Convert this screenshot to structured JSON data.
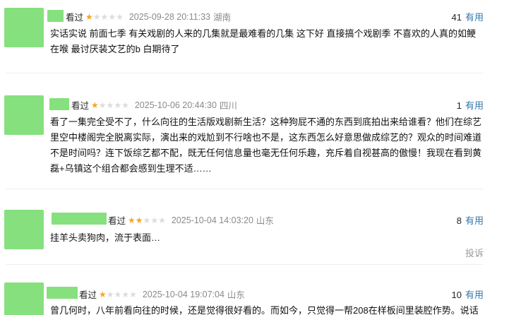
{
  "reviews": [
    {
      "label": "看过",
      "rating": 1,
      "time": "2025-09-28 20:11:33",
      "location": "湖南",
      "useful_count": "41",
      "useful_label": "有用",
      "text": "实话实说 前面七季 有关戏剧的人来的几集就是最难看的几集 这下好 直接搞个戏剧季 不喜欢的人真的如鲠在喉 最讨厌装文艺的b 白期待了"
    },
    {
      "label": "看过",
      "rating": 1,
      "time": "2025-10-06 20:44:30",
      "location": "四川",
      "useful_count": "1",
      "useful_label": "有用",
      "text": "看了一集完全受不了，什么向往的生活版戏剧新生活？这种狗屁不通的东西到底拍出来给谁看？他们在综艺里空中楼阁完全脱离实际，演出来的戏尬到不行啥也不是，这东西怎么好意思做成综艺的？观众的时间难道不是时间吗？连下饭综艺都不配，既无任何信息量也毫无任何乐趣，充斥着自视甚高的傲慢！我现在看到黄磊+乌镇这个组合都会感到生理不适……"
    },
    {
      "label": "看过",
      "rating": 2,
      "time": "2025-10-04 14:03:20",
      "location": "山东",
      "useful_count": "8",
      "useful_label": "有用",
      "text": "挂羊头卖狗肉，流于表面…",
      "report_label": "投诉"
    },
    {
      "label": "看过",
      "rating": 1,
      "time": "2025-10-04 19:07:04",
      "location": "山东",
      "useful_count": "10",
      "useful_label": "有用",
      "text": "曾几何时，八年前看向往的时候，还是觉得很好看的。而如今，只觉得一帮208在样板间里装腔作势。说话"
    }
  ],
  "colors": {
    "avatar": "#86e07e",
    "star_on": "#f5a623",
    "star_off": "#dcdcdc",
    "link": "#3377aa"
  }
}
